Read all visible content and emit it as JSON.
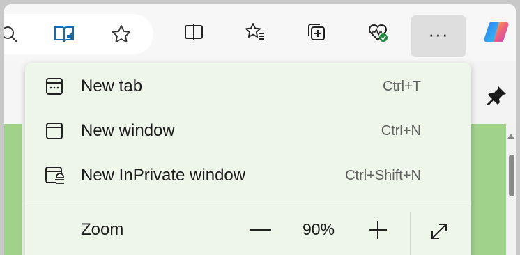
{
  "toolbar": {
    "icons": [
      "search-icon",
      "read-aloud-icon",
      "favorite-star-icon",
      "split-screen-icon",
      "favorites-icon",
      "collections-icon",
      "browser-essentials-icon",
      "settings-and-more-icon",
      "copilot-icon"
    ],
    "more_label": "···"
  },
  "menu": {
    "items": [
      {
        "label": "New tab",
        "shortcut": "Ctrl+T",
        "icon": "new-tab-icon"
      },
      {
        "label": "New window",
        "shortcut": "Ctrl+N",
        "icon": "new-window-icon"
      },
      {
        "label": "New InPrivate window",
        "shortcut": "Ctrl+Shift+N",
        "icon": "inprivate-icon"
      }
    ],
    "zoom": {
      "label": "Zoom",
      "value": "90%",
      "minus_icon": "zoom-out-icon",
      "plus_icon": "zoom-in-icon",
      "fullscreen_icon": "fullscreen-icon"
    }
  },
  "colors": {
    "menu_bg": "#eef6ea",
    "page_green": "#a1d28b",
    "toolbar_bg": "#f7f7f7",
    "essentials_badge": "#1e8e3e"
  },
  "sidebar": {
    "pin_icon": "pin-icon"
  }
}
